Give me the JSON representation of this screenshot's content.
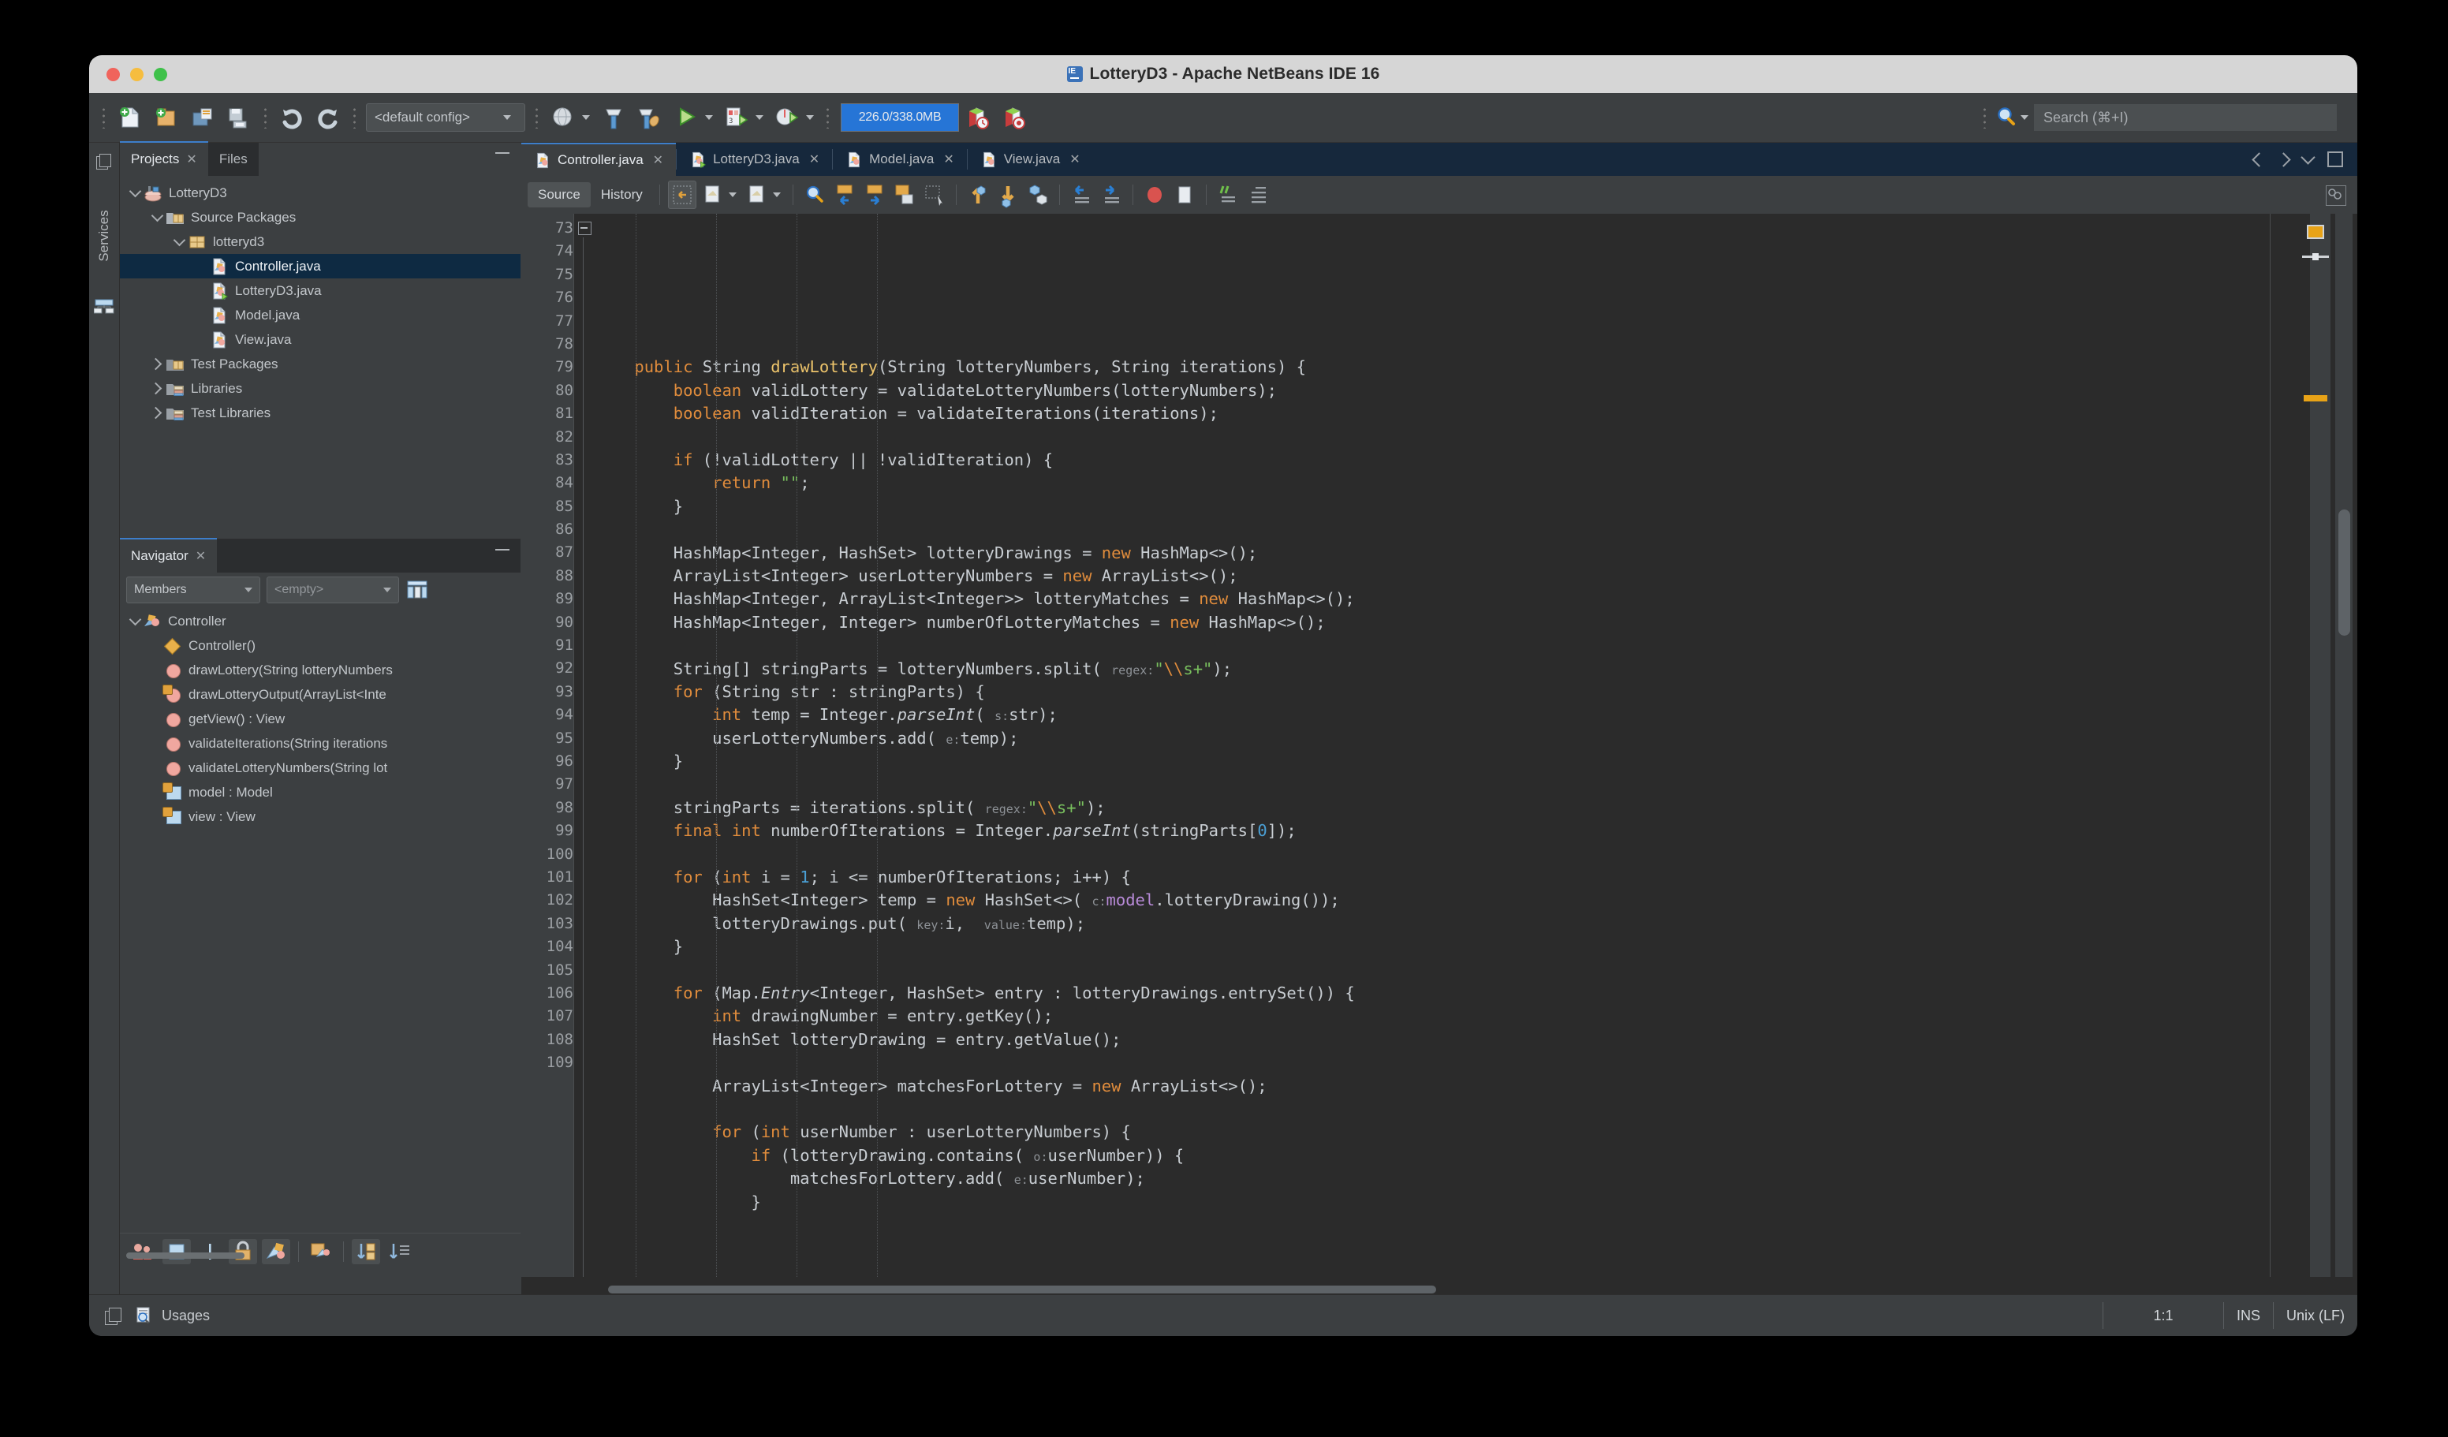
{
  "window": {
    "title": "LotteryD3 - Apache NetBeans IDE 16",
    "app_icon": "netbeans-ide-icon",
    "traffic_lights": [
      "close-button",
      "minimize-button",
      "zoom-button"
    ]
  },
  "toolbar": {
    "buttons": [
      {
        "name": "new-file-button",
        "icon": "new-file-icon"
      },
      {
        "name": "new-project-button",
        "icon": "new-project-icon"
      },
      {
        "name": "open-project-button",
        "icon": "open-project-icon"
      },
      {
        "name": "save-all-button",
        "icon": "save-all-icon"
      },
      {
        "name": "undo-button",
        "icon": "undo-icon"
      },
      {
        "name": "redo-button",
        "icon": "redo-icon"
      }
    ],
    "config_selector": "<default config>",
    "run_buttons": [
      {
        "name": "set-browser-button",
        "icon": "globe-icon"
      },
      {
        "name": "build-project-button",
        "icon": "hammer-icon"
      },
      {
        "name": "clean-and-build-button",
        "icon": "hammer-broom-icon"
      },
      {
        "name": "run-project-button",
        "icon": "play-icon"
      },
      {
        "name": "debug-project-button",
        "icon": "debug-icon"
      },
      {
        "name": "profile-project-button",
        "icon": "profile-icon"
      }
    ],
    "memory_label": "226.0/338.0MB",
    "heap_buttons": [
      {
        "name": "gc-history-button",
        "icon": "book-clock-icon"
      },
      {
        "name": "gc-button",
        "icon": "book-target-icon"
      }
    ],
    "search_placeholder": "Search (⌘+I)",
    "search_value": "",
    "search_icon": "search-icon"
  },
  "services_strip": {
    "label": "Services",
    "documents_icon": "documents-icon",
    "services_icon": "server-icon"
  },
  "projects_panel": {
    "tabs": [
      {
        "label": "Projects",
        "active": true,
        "closable": true
      },
      {
        "label": "Files",
        "active": false,
        "closable": false
      }
    ],
    "minimize_label": "—",
    "tree": [
      {
        "label": "LotteryD3",
        "depth": 0,
        "twisty": "down",
        "icon": "project-icon",
        "selected": false
      },
      {
        "label": "Source Packages",
        "depth": 1,
        "twisty": "down",
        "icon": "source-packages-icon",
        "selected": false
      },
      {
        "label": "lotteryd3",
        "depth": 2,
        "twisty": "down",
        "icon": "package-icon",
        "selected": false
      },
      {
        "label": "Controller.java",
        "depth": 3,
        "twisty": "none",
        "icon": "java-file-icon",
        "selected": true
      },
      {
        "label": "LotteryD3.java",
        "depth": 3,
        "twisty": "none",
        "icon": "java-main-file-icon",
        "selected": false
      },
      {
        "label": "Model.java",
        "depth": 3,
        "twisty": "none",
        "icon": "java-file-icon",
        "selected": false
      },
      {
        "label": "View.java",
        "depth": 3,
        "twisty": "none",
        "icon": "java-file-icon",
        "selected": false
      },
      {
        "label": "Test Packages",
        "depth": 1,
        "twisty": "right",
        "icon": "test-packages-icon",
        "selected": false
      },
      {
        "label": "Libraries",
        "depth": 1,
        "twisty": "right",
        "icon": "libraries-icon",
        "selected": false
      },
      {
        "label": "Test Libraries",
        "depth": 1,
        "twisty": "right",
        "icon": "test-libraries-icon",
        "selected": false
      }
    ]
  },
  "navigator_panel": {
    "tab_label": "Navigator",
    "minimize_label": "—",
    "scope_selector": "Members",
    "filter_selector": "<empty>",
    "inspect_icon": "inspect-members-icon",
    "members": [
      {
        "label": "Controller",
        "depth": 0,
        "twisty": "down",
        "icon": "class-icon",
        "badge": "none"
      },
      {
        "label": "Controller()",
        "depth": 1,
        "twisty": "none",
        "icon": "constructor-icon",
        "badge": "none"
      },
      {
        "label": "drawLottery(String lotteryNumbers",
        "depth": 1,
        "twisty": "none",
        "icon": "method-icon",
        "badge": "none"
      },
      {
        "label": "drawLotteryOutput(ArrayList<Inte",
        "depth": 1,
        "twisty": "none",
        "icon": "method-icon",
        "badge": "private-lock"
      },
      {
        "label": "getView() : View",
        "depth": 1,
        "twisty": "none",
        "icon": "method-icon",
        "badge": "none"
      },
      {
        "label": "validateIterations(String iterations",
        "depth": 1,
        "twisty": "none",
        "icon": "method-icon",
        "badge": "none"
      },
      {
        "label": "validateLotteryNumbers(String lot",
        "depth": 1,
        "twisty": "none",
        "icon": "method-icon",
        "badge": "none"
      },
      {
        "label": "model : Model",
        "depth": 1,
        "twisty": "none",
        "icon": "field-icon",
        "badge": "private-lock"
      },
      {
        "label": "view : View",
        "depth": 1,
        "twisty": "none",
        "icon": "field-icon",
        "badge": "private-lock"
      }
    ],
    "toolbar_buttons": [
      {
        "name": "show-inherited-members-button",
        "icon": "inherited-members-icon",
        "active": false
      },
      {
        "name": "show-fields-button",
        "icon": "field-icon",
        "active": true
      },
      {
        "name": "show-constructors-button",
        "icon": "constructor-bar-icon",
        "active": false
      },
      {
        "name": "show-non-public-button",
        "icon": "lock-icon",
        "active": true
      },
      {
        "name": "show-static-button",
        "icon": "static-members-icon",
        "active": true
      },
      {
        "name": "filter-nested-button",
        "icon": "nested-classes-icon",
        "active": false
      },
      {
        "name": "sort-alphabetically-button",
        "icon": "sort-alpha-icon",
        "active": true
      },
      {
        "name": "sort-by-source-button",
        "icon": "sort-source-icon",
        "active": false
      }
    ]
  },
  "editor": {
    "tabs": [
      {
        "label": "Controller.java",
        "active": true,
        "icon": "java-file-icon"
      },
      {
        "label": "LotteryD3.java",
        "active": false,
        "icon": "java-main-file-icon"
      },
      {
        "label": "Model.java",
        "active": false,
        "icon": "java-file-icon"
      },
      {
        "label": "View.java",
        "active": false,
        "icon": "java-file-icon"
      }
    ],
    "tab_controls": [
      {
        "name": "scroll-tabs-left-button",
        "icon": "chevron-left-icon"
      },
      {
        "name": "scroll-tabs-right-button",
        "icon": "chevron-right-icon"
      },
      {
        "name": "show-opened-documents-button",
        "icon": "chevron-down-icon"
      },
      {
        "name": "maximize-window-button",
        "icon": "maximize-icon"
      }
    ],
    "view_tabs": [
      {
        "label": "Source",
        "active": true
      },
      {
        "label": "History",
        "active": false
      }
    ],
    "toolbar_buttons": [
      {
        "name": "toggle-rectangular-selection-button",
        "icon": "rectangular-selection-icon",
        "active": true
      },
      {
        "name": "last-edit-button",
        "icon": "last-edit-icon",
        "active": false
      },
      {
        "name": "back-edit-button",
        "icon": "back-edit-icon",
        "active": false
      },
      {
        "name": "find-selection-button",
        "icon": "find-selection-icon",
        "active": false
      },
      {
        "name": "find-previous-button",
        "icon": "find-previous-icon",
        "active": false
      },
      {
        "name": "find-next-button",
        "icon": "find-next-icon",
        "active": false
      },
      {
        "name": "toggle-highlight-search-button",
        "icon": "highlight-search-icon",
        "active": false
      },
      {
        "name": "toggle-rect-select-button",
        "icon": "rect-select-icon",
        "active": false
      },
      {
        "name": "previous-bookmark-button",
        "icon": "arrow-up-icon",
        "active": false
      },
      {
        "name": "next-bookmark-button",
        "icon": "arrow-down-icon",
        "active": false
      },
      {
        "name": "toggle-bookmark-button",
        "icon": "bookmark-icon",
        "active": false
      },
      {
        "name": "shift-left-button",
        "icon": "shift-left-icon",
        "active": false
      },
      {
        "name": "shift-right-button",
        "icon": "shift-right-icon",
        "active": false
      },
      {
        "name": "toggle-breakpoint-button",
        "icon": "breakpoint-icon",
        "active": false
      },
      {
        "name": "stop-button",
        "icon": "stop-icon",
        "active": false
      },
      {
        "name": "comment-button",
        "icon": "comment-icon",
        "active": false
      },
      {
        "name": "uncomment-button",
        "icon": "uncomment-icon",
        "active": false
      }
    ],
    "editor_config_button": "editor-settings-icon",
    "first_line": 73,
    "lines": [
      {
        "n": 73,
        "html": "    <span class='kw'>public</span> String <span class='mth'>drawLottery</span>(String lotteryNumbers, String iterations) {"
      },
      {
        "n": 74,
        "html": "        <span class='kw'>boolean</span> validLottery = validateLotteryNumbers(lotteryNumbers);"
      },
      {
        "n": 75,
        "html": "        <span class='kw'>boolean</span> validIteration = validateIterations(iterations);"
      },
      {
        "n": 76,
        "html": ""
      },
      {
        "n": 77,
        "html": "        <span class='kw'>if</span> (!validLottery || !validIteration) {"
      },
      {
        "n": 78,
        "html": "            <span class='kw'>return</span> <span class='str'>\"\"</span>;"
      },
      {
        "n": 79,
        "html": "        }"
      },
      {
        "n": 80,
        "html": ""
      },
      {
        "n": 81,
        "html": "        HashMap&lt;Integer, HashSet&gt; lotteryDrawings = <span class='kw'>new</span> HashMap&lt;&gt;();"
      },
      {
        "n": 82,
        "html": "        ArrayList&lt;Integer&gt; userLotteryNumbers = <span class='kw'>new</span> ArrayList&lt;&gt;();"
      },
      {
        "n": 83,
        "html": "        HashMap&lt;Integer, ArrayList&lt;Integer&gt;&gt; lotteryMatches = <span class='kw'>new</span> HashMap&lt;&gt;();"
      },
      {
        "n": 84,
        "html": "        HashMap&lt;Integer, Integer&gt; numberOfLotteryMatches = <span class='kw'>new</span> HashMap&lt;&gt;();"
      },
      {
        "n": 85,
        "html": ""
      },
      {
        "n": 86,
        "html": "        String[] stringParts = lotteryNumbers.split( <span class='hint'>regex:</span><span class='str'>\"</span><span class='esc'>\\\\</span><span class='str'>s+\"</span>);"
      },
      {
        "n": 87,
        "html": "        <span class='kw'>for</span> (String str : stringParts) {"
      },
      {
        "n": 88,
        "html": "            <span class='kw'>int</span> temp = Integer.<span class='ita'>parseInt</span>( <span class='hint'>s:</span>str);"
      },
      {
        "n": 89,
        "html": "            userLotteryNumbers.add( <span class='hint'>e:</span>temp);"
      },
      {
        "n": 90,
        "html": "        }"
      },
      {
        "n": 91,
        "html": ""
      },
      {
        "n": 92,
        "html": "        stringParts = iterations.split( <span class='hint'>regex:</span><span class='str'>\"</span><span class='esc'>\\\\</span><span class='str'>s+\"</span>);"
      },
      {
        "n": 93,
        "html": "        <span class='kw'>final</span> <span class='kw'>int</span> numberOfIterations = Integer.<span class='ita'>parseInt</span>(stringParts[<span class='num'>0</span>]);"
      },
      {
        "n": 94,
        "html": ""
      },
      {
        "n": 95,
        "html": "        <span class='kw'>for</span> (<span class='kw'>int</span> i = <span class='num'>1</span>; i &lt;= numberOfIterations; i++) {"
      },
      {
        "n": 96,
        "html": "            HashSet&lt;Integer&gt; temp = <span class='kw'>new</span> HashSet&lt;&gt;( <span class='hint'>c:</span><span class='fld'>model</span>.lotteryDrawing());"
      },
      {
        "n": 97,
        "html": "            lotteryDrawings.put( <span class='hint'>key:</span>i,  <span class='hint'>value:</span>temp);"
      },
      {
        "n": 98,
        "html": "        }"
      },
      {
        "n": 99,
        "html": ""
      },
      {
        "n": 100,
        "html": "        <span class='kw'>for</span> (Map.<span class='ita'>Entry</span>&lt;Integer, HashSet&gt; entry : lotteryDrawings.entrySet()) {"
      },
      {
        "n": 101,
        "html": "            <span class='kw'>int</span> drawingNumber = entry.getKey();"
      },
      {
        "n": 102,
        "html": "            HashSet lotteryDrawing = entry.getValue();"
      },
      {
        "n": 103,
        "html": ""
      },
      {
        "n": 104,
        "html": "            ArrayList&lt;Integer&gt; matchesForLottery = <span class='kw'>new</span> ArrayList&lt;&gt;();"
      },
      {
        "n": 105,
        "html": ""
      },
      {
        "n": 106,
        "html": "            <span class='kw'>for</span> (<span class='kw'>int</span> userNumber : userLotteryNumbers) {"
      },
      {
        "n": 107,
        "html": "                <span class='kw'>if</span> (lotteryDrawing.contains( <span class='hint'>o:</span>userNumber)) {"
      },
      {
        "n": 108,
        "html": "                    matchesForLottery.add( <span class='hint'>e:</span>userNumber);"
      },
      {
        "n": 109,
        "html": "                }"
      }
    ]
  },
  "status_bar": {
    "documents_icon": "documents-icon",
    "usages_icon": "usages-icon",
    "usages_label": "Usages",
    "caret_position": "1:1",
    "insert_mode": "INS",
    "line_ending": "Unix (LF)"
  },
  "colors": {
    "accent_blue": "#2675d6",
    "tab_active_border": "#3d7eca",
    "selection_navy": "#0e2a42",
    "editor_bg": "#2b2b2b",
    "panel_bg": "#3c3f41",
    "keyword_orange": "#e08c3c",
    "string_green": "#79c05e",
    "number_blue": "#4a9fd4",
    "field_purple": "#b98bd9",
    "warning_orange": "#e8a317"
  }
}
